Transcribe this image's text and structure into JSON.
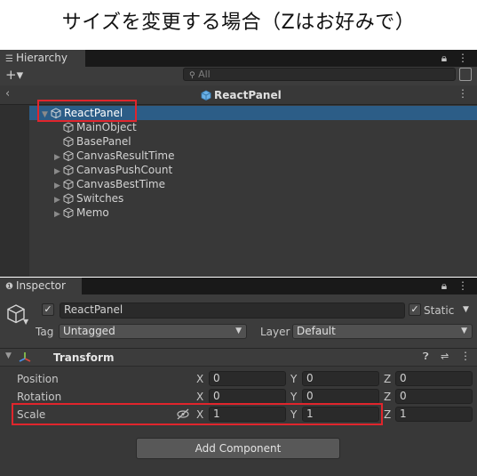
{
  "caption": "サイズを変更する場合（Zはお好みで）",
  "hierarchy": {
    "tab_label": "Hierarchy",
    "tab_icon": "list-icon",
    "add_button": "+▾",
    "search_placeholder": "All",
    "scene_name": "ReactPanel",
    "items": [
      {
        "label": "ReactPanel",
        "expanded": true,
        "selected": true
      },
      {
        "label": "MainObject"
      },
      {
        "label": "BasePanel"
      },
      {
        "label": "CanvasResultTime",
        "has_children": true
      },
      {
        "label": "CanvasPushCount",
        "has_children": true
      },
      {
        "label": "CanvasBestTime",
        "has_children": true
      },
      {
        "label": "Switches",
        "has_children": true
      },
      {
        "label": "Memo",
        "has_children": true
      }
    ]
  },
  "inspector": {
    "tab_label": "Inspector",
    "object_name": "ReactPanel",
    "active": true,
    "static_label": "Static",
    "static_checked": true,
    "tag_label": "Tag",
    "tag_value": "Untagged",
    "layer_label": "Layer",
    "layer_value": "Default",
    "component_title": "Transform",
    "axis_labels": [
      "X",
      "Y",
      "Z"
    ],
    "position": {
      "label": "Position",
      "x": "0",
      "y": "0",
      "z": "0"
    },
    "rotation": {
      "label": "Rotation",
      "x": "0",
      "y": "0",
      "z": "0"
    },
    "scale": {
      "label": "Scale",
      "x": "1",
      "y": "1",
      "z": "1"
    },
    "add_component_label": "Add Component"
  },
  "colors": {
    "highlight": "#e0252c",
    "selection": "#2c5d87",
    "panel_bg": "#383838",
    "header_bg": "#3c3c3c"
  }
}
